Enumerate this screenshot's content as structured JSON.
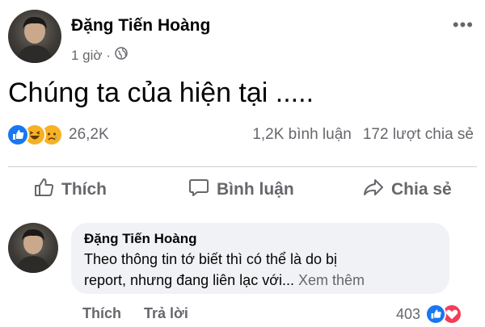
{
  "post": {
    "author": "Đặng Tiến Hoàng",
    "time": "1 giờ ·",
    "privacy_icon": "globe-icon",
    "text": "Chúng ta của hiện tại .....",
    "reaction_icons": [
      "like-icon",
      "haha-icon",
      "sad-icon"
    ],
    "reaction_count": "26,2K",
    "comments_count": "1,2K bình luận",
    "shares_count": "172 lượt chia sẻ",
    "more_icon": "•••"
  },
  "actions": {
    "like": "Thích",
    "comment": "Bình luận",
    "share": "Chia sẻ"
  },
  "comment": {
    "author": "Đặng Tiến Hoàng",
    "text_line1": "Theo thông tin tớ biết thì có thể là do bị",
    "text_line2": "report, nhưng đang liên lạc với...",
    "see_more": "Xem thêm",
    "like_label": "Thích",
    "reply_label": "Trả lời",
    "reaction_count": "403",
    "reaction_icons": [
      "like-icon",
      "love-icon"
    ]
  },
  "colors": {
    "facebook_blue": "#1877f2",
    "secondary_text": "#65676b",
    "bubble_bg": "#f0f2f5",
    "love_red": "#f33e58",
    "haha_yellow": "#f7b125"
  }
}
